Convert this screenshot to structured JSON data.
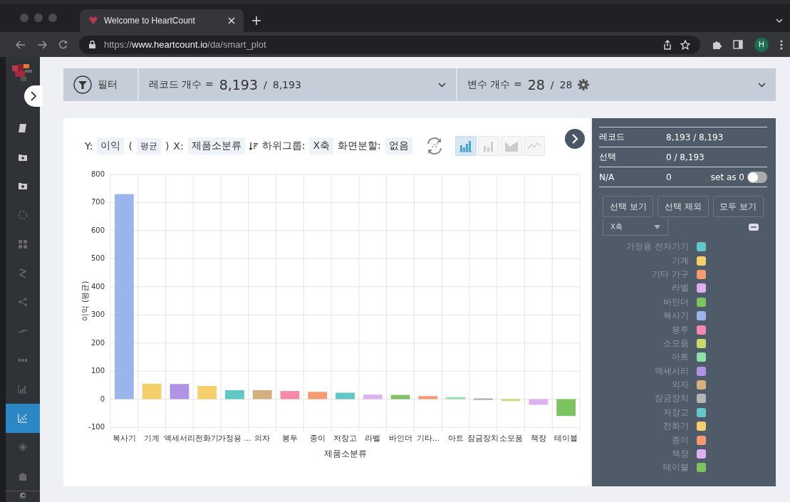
{
  "browser": {
    "tab_title": "Welcome to HeartCount",
    "url": "https://**www.heartcount.io**/da/smart_plot",
    "profile": "H"
  },
  "sidebar": {
    "items": [
      {
        "kind": "book",
        "selected": false
      },
      {
        "kind": "folder-plus",
        "selected": false
      },
      {
        "kind": "folder-camera",
        "selected": false
      },
      {
        "kind": "gauge",
        "selected": false
      },
      {
        "kind": "grid",
        "selected": false
      },
      {
        "kind": "zigzag",
        "selected": false
      },
      {
        "kind": "share",
        "selected": false
      },
      {
        "kind": "arrows",
        "selected": false
      },
      {
        "kind": "dots",
        "selected": false
      },
      {
        "kind": "bar-chart",
        "selected": false
      },
      {
        "kind": "scatter",
        "selected": true
      },
      {
        "kind": "snowflake",
        "selected": false
      },
      {
        "kind": "building",
        "selected": false
      }
    ],
    "footer": "©"
  },
  "filter_bar": {
    "filter_label": "필터",
    "records_label": "레코드 개수 =",
    "records_value": "8,193",
    "records_sep": "/",
    "records_total": "8,193",
    "vars_label": "변수 개수 =",
    "vars_value": "28",
    "vars_sep": "/",
    "vars_total": "28"
  },
  "toolbar": {
    "y_label": "Y:",
    "y_value": "이익",
    "paren_open": "(",
    "aggregate": "평균",
    "paren_close": ")",
    "x_label": "X:",
    "x_value": "제품소분류",
    "subgroup_label": "하위그룹:",
    "subgroup_value": "X축",
    "split_label": "화면분할:",
    "split_value": "없음",
    "chart_types": [
      {
        "kind": "bar",
        "selected": true
      },
      {
        "kind": "bar-plain",
        "selected": false
      },
      {
        "kind": "area",
        "selected": false
      },
      {
        "kind": "line",
        "selected": false
      }
    ]
  },
  "chart_data": {
    "type": "bar",
    "xlabel": "제품소분류",
    "ylabel": "이익 (평균)",
    "ylim": [
      -100,
      800
    ],
    "yticks": [
      -100,
      0,
      100,
      200,
      300,
      400,
      500,
      600,
      700,
      800
    ],
    "categories": [
      "복사기",
      "기계",
      "액세서리",
      "전화기",
      "가정용 ...",
      "의자",
      "봉투",
      "종이",
      "저장고",
      "라벨",
      "바인더",
      "기타...",
      "아트",
      "잠금장치",
      "소모품",
      "책장",
      "테이블"
    ],
    "grid": true,
    "series": [
      {
        "values": [
          730,
          55,
          54,
          47,
          32,
          32,
          29,
          26,
          23,
          16,
          15,
          11,
          7,
          3,
          -5,
          -20,
          -60
        ]
      }
    ],
    "colors": [
      "#9bb5ec",
      "#f5cf6b",
      "#b093e6",
      "#f5cf6b",
      "#62c7c7",
      "#d4b07f",
      "#f58aab",
      "#f59b72",
      "#62c7c7",
      "#deb0f0",
      "#7dc35f",
      "#f59b72",
      "#8ee0a8",
      "#b5b5b5",
      "#c9dc6a",
      "#deb0f0",
      "#7dc35f"
    ]
  },
  "panel": {
    "stats": [
      {
        "label": "레코드",
        "value": "8,193 / 8,193"
      },
      {
        "label": "선택",
        "value": "0 / 8,193"
      },
      {
        "label": "N/A",
        "value": "0"
      }
    ],
    "set_zero_label": "set as 0",
    "set_zero_on": false,
    "buttons": [
      "선택 보기",
      "선택 제외",
      "모두 보기"
    ],
    "group_select": "X축",
    "legend": [
      {
        "label": "가정용 전자기기",
        "color": "#62c7c7"
      },
      {
        "label": "기계",
        "color": "#f5cf6b"
      },
      {
        "label": "기타 가구",
        "color": "#f59b72"
      },
      {
        "label": "라벨",
        "color": "#deb0f0"
      },
      {
        "label": "바인더",
        "color": "#7dc35f"
      },
      {
        "label": "복사기",
        "color": "#9bb5ec"
      },
      {
        "label": "봉투",
        "color": "#f58aab"
      },
      {
        "label": "소모품",
        "color": "#c9dc6a"
      },
      {
        "label": "아트",
        "color": "#8ee0a8"
      },
      {
        "label": "액세서리",
        "color": "#b093e6"
      },
      {
        "label": "의자",
        "color": "#d4b07f"
      },
      {
        "label": "잠금장치",
        "color": "#b5b5b5"
      },
      {
        "label": "저장고",
        "color": "#62c7c7"
      },
      {
        "label": "전화기",
        "color": "#f5cf6b"
      },
      {
        "label": "종이",
        "color": "#f59b72"
      },
      {
        "label": "책장",
        "color": "#deb0f0"
      },
      {
        "label": "테이블",
        "color": "#7dc35f"
      }
    ]
  }
}
